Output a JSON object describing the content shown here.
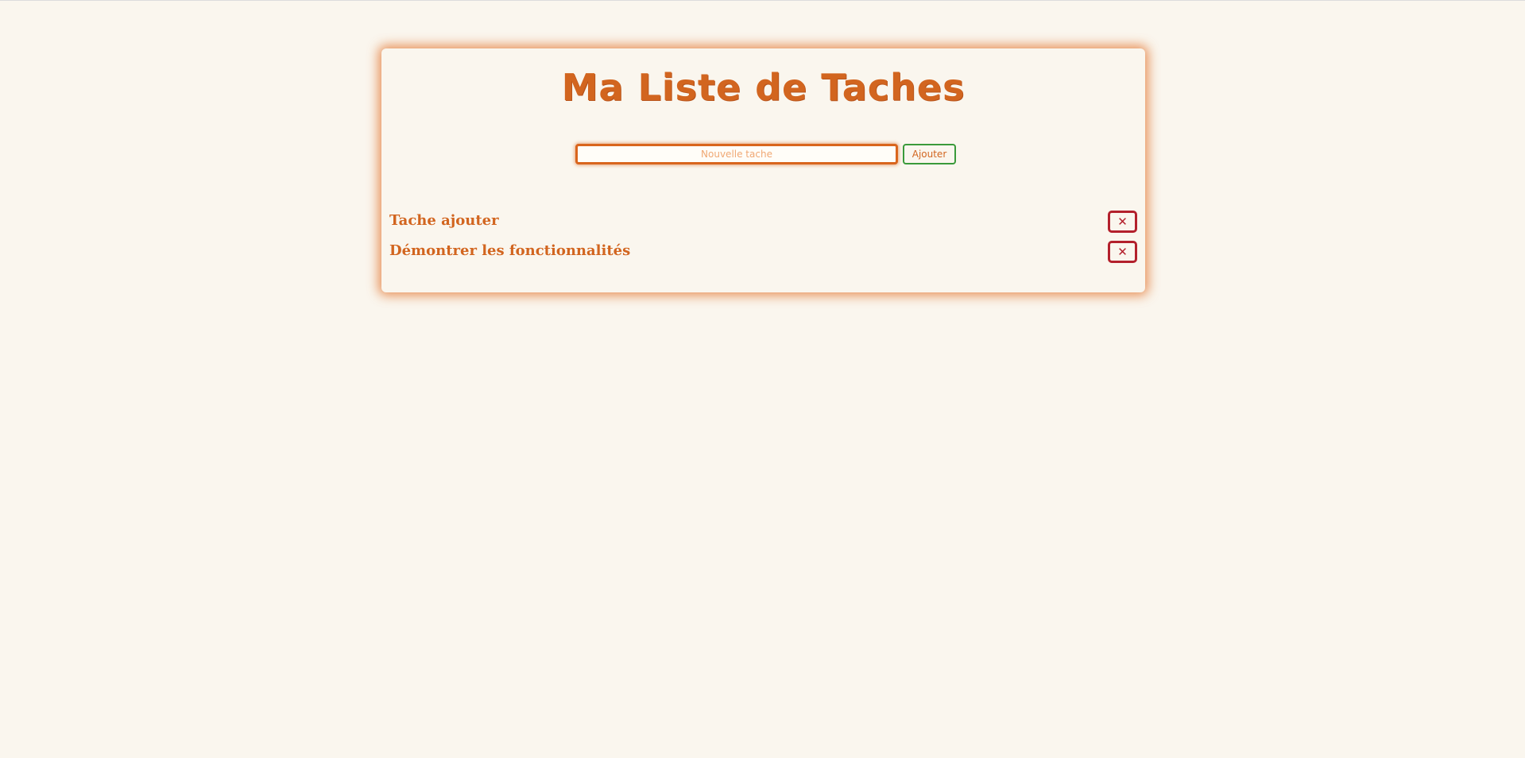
{
  "app": {
    "title": "Ma Liste de Taches"
  },
  "form": {
    "input_value": "",
    "input_placeholder": "Nouvelle tache",
    "add_label": "Ajouter"
  },
  "tasks": [
    {
      "label": "Tache ajouter",
      "delete_label": "✕"
    },
    {
      "label": "Démontrer les fonctionnalités",
      "delete_label": "✕"
    }
  ],
  "colors": {
    "background": "#faf6ee",
    "accent": "#d2651f",
    "add_border": "#3a9a3a",
    "delete": "#b3202c"
  },
  "icons": {
    "delete": "close-icon"
  }
}
